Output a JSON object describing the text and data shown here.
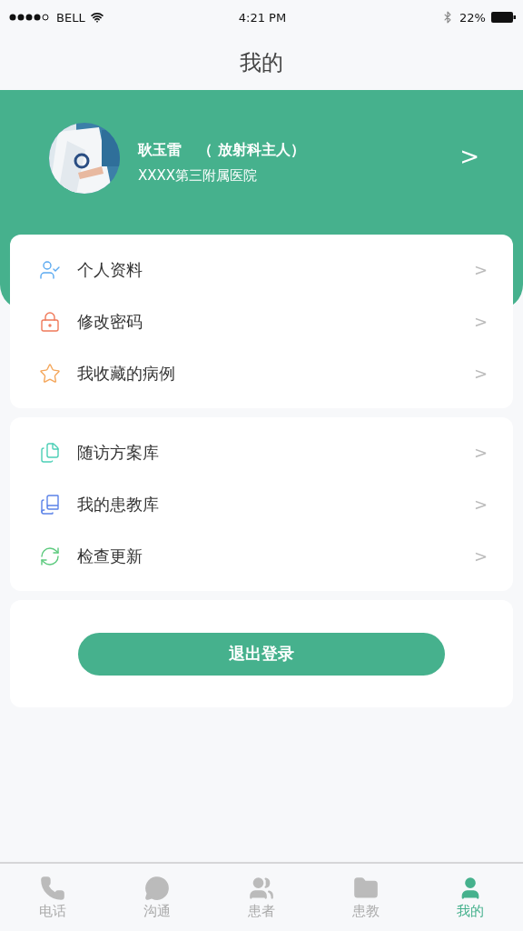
{
  "status_bar": {
    "carrier": "BELL",
    "time": "4:21 PM",
    "battery": "22%"
  },
  "title": "我的",
  "profile": {
    "name": "耿玉雷",
    "role": "（  放射科主人）",
    "hospital": "XXXX第三附属医院",
    "arrow": ">"
  },
  "menu_groups": [
    {
      "items": [
        {
          "kind": "user",
          "label": "个人资料",
          "arrow": ">"
        },
        {
          "kind": "lock",
          "label": "修改密码",
          "arrow": ">"
        },
        {
          "kind": "star",
          "label": "我收藏的病例",
          "arrow": ">"
        }
      ]
    },
    {
      "items": [
        {
          "kind": "files",
          "label": "随访方案库",
          "arrow": ">"
        },
        {
          "kind": "book",
          "label": "我的患教库",
          "arrow": ">"
        },
        {
          "kind": "refresh",
          "label": "检查更新",
          "arrow": ">"
        }
      ]
    }
  ],
  "logout_button": "退出登录",
  "tab_bar": [
    {
      "kind": "phone",
      "label": "电话",
      "selected": false
    },
    {
      "kind": "chat",
      "label": "沟通",
      "selected": false
    },
    {
      "kind": "patients",
      "label": "患者",
      "selected": false
    },
    {
      "kind": "folder",
      "label": "患教",
      "selected": false
    },
    {
      "kind": "me",
      "label": "我的",
      "selected": true
    }
  ]
}
